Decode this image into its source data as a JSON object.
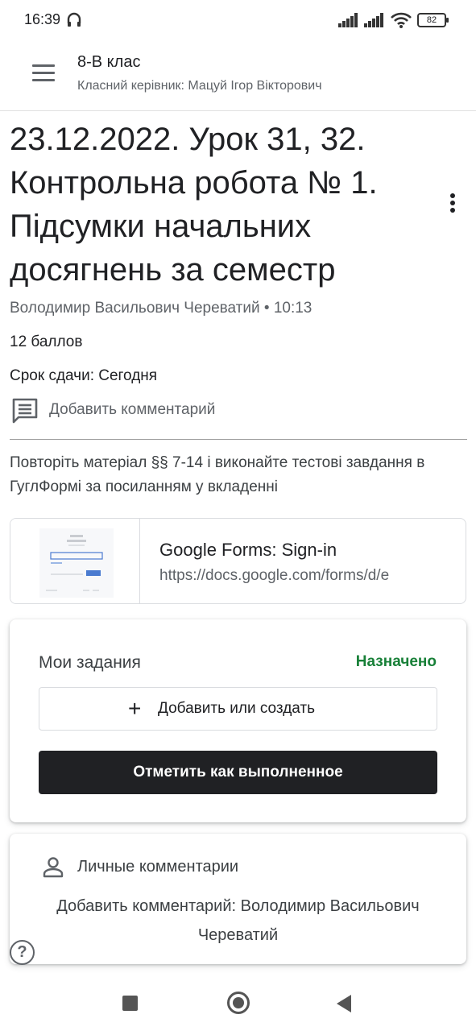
{
  "status_bar": {
    "time": "16:39",
    "battery": "82",
    "icons": [
      "headset-icon",
      "signal-icon",
      "signal-icon",
      "wifi-icon",
      "battery-icon"
    ]
  },
  "app_bar": {
    "title": "8-В клас",
    "subtitle": "Класний керівник: Мацуй Ігор Вікторович",
    "menu_icon": "hamburger-menu-icon"
  },
  "post": {
    "title": "23.12.2022. Урок 31, 32. Контрольна робота № 1. Підсумки начальних досягнень за семестр",
    "author_line": "Володимир Васильович Череватий • 10:13",
    "points": "12 баллов",
    "due": "Срок сдачи: Сегодня",
    "add_comment": "Добавить комментарий",
    "description": "Повторіть матеріал §§ 7-14 і виконайте тестові завдання в ГуглФормі за посиланням у вкладенні"
  },
  "attachment": {
    "title": "Google Forms: Sign-in",
    "url": "https://docs.google.com/forms/d/e"
  },
  "my_work": {
    "title": "Мои задания",
    "status": "Назначено",
    "add_label": "Добавить или создать",
    "done_label": "Отметить как выполненное"
  },
  "private_comments": {
    "title": "Личные комментарии",
    "add_prompt": "Добавить комментарий: Володимир Васильович Череватий"
  },
  "colors": {
    "accent_green": "#188038",
    "button_dark": "#202124",
    "text_primary": "#202124",
    "text_secondary": "#5f6368"
  }
}
